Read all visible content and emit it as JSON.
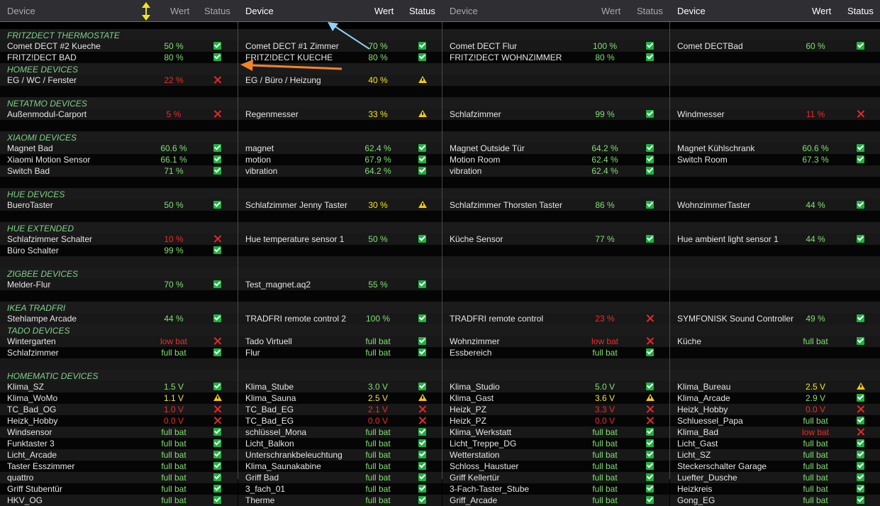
{
  "columns": [
    {
      "header": {
        "device": "Device",
        "wert": "Wert",
        "status": "Status",
        "style": "dim"
      },
      "rows": [
        {
          "t": "cat",
          "label": "FRITZDECT THERMOSTATE"
        },
        {
          "t": "item",
          "name": "Comet DECT #2 Kueche",
          "value": "50 %",
          "vc": "ok",
          "status": "ok"
        },
        {
          "t": "item",
          "name": "FRITZ!DECT BAD",
          "value": "80 %",
          "vc": "ok",
          "status": "ok"
        },
        {
          "t": "cat",
          "label": "HOMEE DEVICES"
        },
        {
          "t": "item",
          "name": "EG / WC / Fenster",
          "value": "22 %",
          "vc": "bad",
          "status": "bad"
        },
        {
          "t": "blank"
        },
        {
          "t": "cat",
          "label": "NETATMO DEVICES"
        },
        {
          "t": "item",
          "name": "Außenmodul-Carport",
          "value": "5 %",
          "vc": "bad",
          "status": "bad"
        },
        {
          "t": "blank"
        },
        {
          "t": "cat",
          "label": "XIAOMI DEVICES"
        },
        {
          "t": "item",
          "name": "Magnet Bad",
          "value": "60.6 %",
          "vc": "ok",
          "status": "ok"
        },
        {
          "t": "item",
          "name": "Xiaomi Motion Sensor",
          "value": "66.1 %",
          "vc": "ok",
          "status": "ok"
        },
        {
          "t": "item",
          "name": "Switch Bad",
          "value": "71 %",
          "vc": "ok",
          "status": "ok"
        },
        {
          "t": "blank"
        },
        {
          "t": "cat",
          "label": "HUE DEVICES"
        },
        {
          "t": "item",
          "name": "BueroTaster",
          "value": "50 %",
          "vc": "ok",
          "status": "ok"
        },
        {
          "t": "blank"
        },
        {
          "t": "cat",
          "label": "HUE EXTENDED"
        },
        {
          "t": "item",
          "name": "Schlafzimmer Schalter",
          "value": "10 %",
          "vc": "bad",
          "status": "bad"
        },
        {
          "t": "item",
          "name": "Büro Schalter",
          "value": "99 %",
          "vc": "ok",
          "status": "ok"
        },
        {
          "t": "blank"
        },
        {
          "t": "cat",
          "label": "ZIGBEE DEVICES"
        },
        {
          "t": "item",
          "name": "Melder-Flur",
          "value": "70 %",
          "vc": "ok",
          "status": "ok"
        },
        {
          "t": "blank"
        },
        {
          "t": "cat",
          "label": "IKEA TRADFRI"
        },
        {
          "t": "item",
          "name": "Stehlampe Arcade",
          "value": "44 %",
          "vc": "ok",
          "status": "ok"
        },
        {
          "t": "cat",
          "label": "TADO DEVICES"
        },
        {
          "t": "item",
          "name": "Wintergarten",
          "value": "low bat",
          "vc": "bad",
          "status": "bad"
        },
        {
          "t": "item",
          "name": "Schlafzimmer",
          "value": "full bat",
          "vc": "ok",
          "status": "ok"
        },
        {
          "t": "blank"
        },
        {
          "t": "cat",
          "label": "HOMEMATIC DEVICES"
        },
        {
          "t": "item",
          "name": "Klima_SZ",
          "value": "1.5 V",
          "vc": "ok",
          "status": "ok"
        },
        {
          "t": "item",
          "name": "Klima_WoMo",
          "value": "1.1 V",
          "vc": "warn",
          "status": "warn"
        },
        {
          "t": "item",
          "name": "TC_Bad_OG",
          "value": "1.0 V",
          "vc": "bad",
          "status": "bad"
        },
        {
          "t": "item",
          "name": "Heizk_Hobby",
          "value": "0.0 V",
          "vc": "bad",
          "status": "bad"
        },
        {
          "t": "item",
          "name": "Windsensor",
          "value": "full bat",
          "vc": "ok",
          "status": "ok"
        },
        {
          "t": "item",
          "name": "Funktaster 3",
          "value": "full bat",
          "vc": "ok",
          "status": "ok"
        },
        {
          "t": "item",
          "name": "Licht_Arcade",
          "value": "full bat",
          "vc": "ok",
          "status": "ok"
        },
        {
          "t": "item",
          "name": "Taster Esszimmer",
          "value": "full bat",
          "vc": "ok",
          "status": "ok"
        },
        {
          "t": "item",
          "name": "quattro",
          "value": "full bat",
          "vc": "ok",
          "status": "ok"
        },
        {
          "t": "item",
          "name": "Griff Stubentür",
          "value": "full bat",
          "vc": "ok",
          "status": "ok"
        },
        {
          "t": "item",
          "name": "HKV_OG",
          "value": "full bat",
          "vc": "ok",
          "status": "ok"
        }
      ]
    },
    {
      "header": {
        "device": "Device",
        "wert": "Wert",
        "status": "Status",
        "style": "bright"
      },
      "rows": [
        {
          "t": "cat",
          "label": ""
        },
        {
          "t": "item",
          "name": "Comet DECT #1 Zimmer",
          "value": "70 %",
          "vc": "ok",
          "status": "ok"
        },
        {
          "t": "item",
          "name": "FRITZ!DECT KUECHE",
          "value": "80 %",
          "vc": "ok",
          "status": "ok"
        },
        {
          "t": "cat",
          "label": ""
        },
        {
          "t": "item",
          "name": "EG / Büro / Heizung",
          "value": "40 %",
          "vc": "warn",
          "status": "warn"
        },
        {
          "t": "blank"
        },
        {
          "t": "cat",
          "label": ""
        },
        {
          "t": "item",
          "name": "Regenmesser",
          "value": "33 %",
          "vc": "warn",
          "status": "warn"
        },
        {
          "t": "blank"
        },
        {
          "t": "cat",
          "label": ""
        },
        {
          "t": "item",
          "name": "magnet",
          "value": "62.4 %",
          "vc": "ok",
          "status": "ok"
        },
        {
          "t": "item",
          "name": "motion",
          "value": "67.9 %",
          "vc": "ok",
          "status": "ok"
        },
        {
          "t": "item",
          "name": "vibration",
          "value": "64.2 %",
          "vc": "ok",
          "status": "ok"
        },
        {
          "t": "blank"
        },
        {
          "t": "cat",
          "label": ""
        },
        {
          "t": "item",
          "name": "Schlafzimmer Jenny Taster",
          "value": "30 %",
          "vc": "warn",
          "status": "warn"
        },
        {
          "t": "blank"
        },
        {
          "t": "cat",
          "label": ""
        },
        {
          "t": "item",
          "name": "Hue temperature sensor 1",
          "value": "50 %",
          "vc": "ok",
          "status": "ok"
        },
        {
          "t": "blank"
        },
        {
          "t": "blank"
        },
        {
          "t": "cat",
          "label": ""
        },
        {
          "t": "item",
          "name": "Test_magnet.aq2",
          "value": "55 %",
          "vc": "ok",
          "status": "ok"
        },
        {
          "t": "blank"
        },
        {
          "t": "cat",
          "label": ""
        },
        {
          "t": "item",
          "name": "TRADFRI remote control 2",
          "value": "100 %",
          "vc": "ok",
          "status": "ok"
        },
        {
          "t": "cat",
          "label": ""
        },
        {
          "t": "item",
          "name": "Tado Virtuell",
          "value": "full bat",
          "vc": "ok",
          "status": "ok"
        },
        {
          "t": "item",
          "name": "Flur",
          "value": "full bat",
          "vc": "ok",
          "status": "ok"
        },
        {
          "t": "blank"
        },
        {
          "t": "cat",
          "label": ""
        },
        {
          "t": "item",
          "name": "Klima_Stube",
          "value": "3.0 V",
          "vc": "ok",
          "status": "ok"
        },
        {
          "t": "item",
          "name": "Klima_Sauna",
          "value": "2.5 V",
          "vc": "warn",
          "status": "warn"
        },
        {
          "t": "item",
          "name": "TC_Bad_EG",
          "value": "2.1 V",
          "vc": "bad",
          "status": "bad"
        },
        {
          "t": "item",
          "name": "TC_Bad_EG",
          "value": "0.0 V",
          "vc": "bad",
          "status": "bad"
        },
        {
          "t": "item",
          "name": "schlüssel_Mona",
          "value": "full bat",
          "vc": "ok",
          "status": "ok"
        },
        {
          "t": "item",
          "name": "Licht_Balkon",
          "value": "full bat",
          "vc": "ok",
          "status": "ok"
        },
        {
          "t": "item",
          "name": "Unterschrankbeleuchtung",
          "value": "full bat",
          "vc": "ok",
          "status": "ok"
        },
        {
          "t": "item",
          "name": "Klima_Saunakabine",
          "value": "full bat",
          "vc": "ok",
          "status": "ok"
        },
        {
          "t": "item",
          "name": "Griff Bad",
          "value": "full bat",
          "vc": "ok",
          "status": "ok"
        },
        {
          "t": "item",
          "name": "3_fach_01",
          "value": "full bat",
          "vc": "ok",
          "status": "ok"
        },
        {
          "t": "item",
          "name": "Therme",
          "value": "full bat",
          "vc": "ok",
          "status": "ok"
        }
      ]
    },
    {
      "header": {
        "device": "Device",
        "wert": "Wert",
        "status": "Status",
        "style": "dim"
      },
      "rows": [
        {
          "t": "cat",
          "label": ""
        },
        {
          "t": "item",
          "name": "Comet DECT Flur",
          "value": "100 %",
          "vc": "ok",
          "status": "ok"
        },
        {
          "t": "item",
          "name": "FRITZ!DECT WOHNZIMMER",
          "value": "80 %",
          "vc": "ok",
          "status": "ok"
        },
        {
          "t": "cat",
          "label": ""
        },
        {
          "t": "blank"
        },
        {
          "t": "blank"
        },
        {
          "t": "cat",
          "label": ""
        },
        {
          "t": "item",
          "name": "Schlafzimmer",
          "value": "99 %",
          "vc": "ok",
          "status": "ok"
        },
        {
          "t": "blank"
        },
        {
          "t": "cat",
          "label": ""
        },
        {
          "t": "item",
          "name": "Magnet Outside Tür",
          "value": "64.2 %",
          "vc": "ok",
          "status": "ok"
        },
        {
          "t": "item",
          "name": "Motion Room",
          "value": "62.4 %",
          "vc": "ok",
          "status": "ok"
        },
        {
          "t": "item",
          "name": "vibration",
          "value": "62.4 %",
          "vc": "ok",
          "status": "ok"
        },
        {
          "t": "blank"
        },
        {
          "t": "cat",
          "label": ""
        },
        {
          "t": "item",
          "name": "Schlafzimmer Thorsten Taster",
          "value": "86 %",
          "vc": "ok",
          "status": "ok"
        },
        {
          "t": "blank"
        },
        {
          "t": "cat",
          "label": ""
        },
        {
          "t": "item",
          "name": "Küche Sensor",
          "value": "77 %",
          "vc": "ok",
          "status": "ok"
        },
        {
          "t": "blank"
        },
        {
          "t": "blank"
        },
        {
          "t": "cat",
          "label": ""
        },
        {
          "t": "blank"
        },
        {
          "t": "blank"
        },
        {
          "t": "cat",
          "label": ""
        },
        {
          "t": "item",
          "name": "TRADFRI remote control",
          "value": "23 %",
          "vc": "bad",
          "status": "bad"
        },
        {
          "t": "cat",
          "label": ""
        },
        {
          "t": "item",
          "name": "Wohnzimmer",
          "value": "low bat",
          "vc": "bad",
          "status": "bad"
        },
        {
          "t": "item",
          "name": "Essbereich",
          "value": "full bat",
          "vc": "ok",
          "status": "ok"
        },
        {
          "t": "blank"
        },
        {
          "t": "cat",
          "label": ""
        },
        {
          "t": "item",
          "name": "Klima_Studio",
          "value": "5.0 V",
          "vc": "ok",
          "status": "ok"
        },
        {
          "t": "item",
          "name": "Klima_Gast",
          "value": "3.6 V",
          "vc": "warn",
          "status": "warn"
        },
        {
          "t": "item",
          "name": "Heizk_PZ",
          "value": "3.3 V",
          "vc": "bad",
          "status": "bad"
        },
        {
          "t": "item",
          "name": "Heizk_PZ",
          "value": "0.0 V",
          "vc": "bad",
          "status": "bad"
        },
        {
          "t": "item",
          "name": "Klima_Werkstatt",
          "value": "full bat",
          "vc": "ok",
          "status": "ok"
        },
        {
          "t": "item",
          "name": "Licht_Treppe_DG",
          "value": "full bat",
          "vc": "ok",
          "status": "ok"
        },
        {
          "t": "item",
          "name": "Wetterstation",
          "value": "full bat",
          "vc": "ok",
          "status": "ok"
        },
        {
          "t": "item",
          "name": "Schloss_Haustuer",
          "value": "full bat",
          "vc": "ok",
          "status": "ok"
        },
        {
          "t": "item",
          "name": "Griff Kellertür",
          "value": "full bat",
          "vc": "ok",
          "status": "ok"
        },
        {
          "t": "item",
          "name": "3-Fach-Taster_Stube",
          "value": "full bat",
          "vc": "ok",
          "status": "ok"
        },
        {
          "t": "item",
          "name": "Griff_Arcade",
          "value": "full bat",
          "vc": "ok",
          "status": "ok"
        }
      ]
    },
    {
      "header": {
        "device": "Device",
        "wert": "Wert",
        "status": "Status",
        "style": "bright"
      },
      "rows": [
        {
          "t": "cat",
          "label": ""
        },
        {
          "t": "item",
          "name": "Comet DECTBad",
          "value": "60 %",
          "vc": "ok",
          "status": "ok"
        },
        {
          "t": "blank"
        },
        {
          "t": "cat",
          "label": ""
        },
        {
          "t": "blank"
        },
        {
          "t": "blank"
        },
        {
          "t": "cat",
          "label": ""
        },
        {
          "t": "item",
          "name": "Windmesser",
          "value": "11 %",
          "vc": "bad",
          "status": "bad"
        },
        {
          "t": "blank"
        },
        {
          "t": "cat",
          "label": ""
        },
        {
          "t": "item",
          "name": "Magnet Kühlschrank",
          "value": "60.6 %",
          "vc": "ok",
          "status": "ok"
        },
        {
          "t": "item",
          "name": "Switch Room",
          "value": "67.3 %",
          "vc": "ok",
          "status": "ok"
        },
        {
          "t": "blank"
        },
        {
          "t": "blank"
        },
        {
          "t": "cat",
          "label": ""
        },
        {
          "t": "item",
          "name": "WohnzimmerTaster",
          "value": "44 %",
          "vc": "ok",
          "status": "ok"
        },
        {
          "t": "blank"
        },
        {
          "t": "cat",
          "label": ""
        },
        {
          "t": "item",
          "name": "Hue ambient light sensor 1",
          "value": "44 %",
          "vc": "ok",
          "status": "ok"
        },
        {
          "t": "blank"
        },
        {
          "t": "blank"
        },
        {
          "t": "cat",
          "label": ""
        },
        {
          "t": "blank"
        },
        {
          "t": "blank"
        },
        {
          "t": "cat",
          "label": ""
        },
        {
          "t": "item",
          "name": "SYMFONISK Sound Controller",
          "value": "49 %",
          "vc": "ok",
          "status": "ok"
        },
        {
          "t": "cat",
          "label": ""
        },
        {
          "t": "item",
          "name": "Küche",
          "value": "full bat",
          "vc": "ok",
          "status": "ok"
        },
        {
          "t": "blank"
        },
        {
          "t": "blank"
        },
        {
          "t": "cat",
          "label": ""
        },
        {
          "t": "item",
          "name": "Klima_Bureau",
          "value": "2.5 V",
          "vc": "warn",
          "status": "warn"
        },
        {
          "t": "item",
          "name": "Klima_Arcade",
          "value": "2.9 V",
          "vc": "ok",
          "status": "ok"
        },
        {
          "t": "item",
          "name": "Heizk_Hobby",
          "value": "0.0 V",
          "vc": "bad",
          "status": "bad"
        },
        {
          "t": "item",
          "name": "Schluessel_Papa",
          "value": "full bat",
          "vc": "ok",
          "status": "ok"
        },
        {
          "t": "item",
          "name": "Klima_Bad",
          "value": "low bat",
          "vc": "bad",
          "status": "bad"
        },
        {
          "t": "item",
          "name": "Licht_Gast",
          "value": "full bat",
          "vc": "ok",
          "status": "ok"
        },
        {
          "t": "item",
          "name": "Licht_SZ",
          "value": "full bat",
          "vc": "ok",
          "status": "ok"
        },
        {
          "t": "item",
          "name": "Steckerschalter Garage",
          "value": "full bat",
          "vc": "ok",
          "status": "ok"
        },
        {
          "t": "item",
          "name": "Luefter_Dusche",
          "value": "full bat",
          "vc": "ok",
          "status": "ok"
        },
        {
          "t": "item",
          "name": "Heizkreis",
          "value": "full bat",
          "vc": "ok",
          "status": "ok"
        },
        {
          "t": "item",
          "name": "Gong_EG",
          "value": "full bat",
          "vc": "ok",
          "status": "ok"
        }
      ]
    }
  ],
  "colors": {
    "ok": "#7ee06f",
    "warn": "#f2e51b",
    "bad": "#f02b2b",
    "category": "#7fd28a",
    "header_bg": "#2e2e33",
    "annotation_blue": "#8fd3f4",
    "annotation_orange": "#f0852a"
  },
  "icons": {
    "resize_handle": "double-arrow-vertical-icon",
    "status_ok": "check-icon",
    "status_bad": "cross-icon",
    "status_warn": "warning-icon"
  }
}
